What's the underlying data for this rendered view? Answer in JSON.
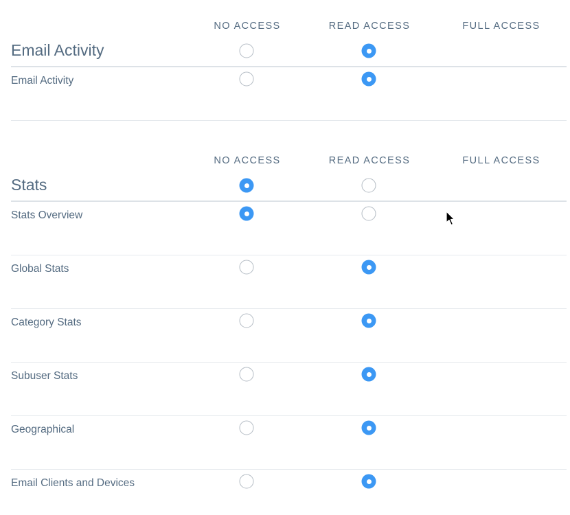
{
  "columns": {
    "no_access": "NO ACCESS",
    "read_access": "READ ACCESS",
    "full_access": "FULL ACCESS"
  },
  "sections": [
    {
      "title": "Email Activity",
      "header_selection": "read",
      "rows": [
        {
          "label": "Email Activity",
          "selection": "read"
        }
      ]
    },
    {
      "title": "Stats",
      "header_selection": "none",
      "rows": [
        {
          "label": "Stats Overview",
          "selection": "none"
        },
        {
          "label": "Global Stats",
          "selection": "read"
        },
        {
          "label": "Category Stats",
          "selection": "read"
        },
        {
          "label": "Subuser Stats",
          "selection": "read"
        },
        {
          "label": "Geographical",
          "selection": "read"
        },
        {
          "label": "Email Clients and Devices",
          "selection": "read"
        }
      ]
    }
  ],
  "colors": {
    "accent": "#3c98f4",
    "text": "#546b81",
    "divider": "#dde2e7"
  }
}
